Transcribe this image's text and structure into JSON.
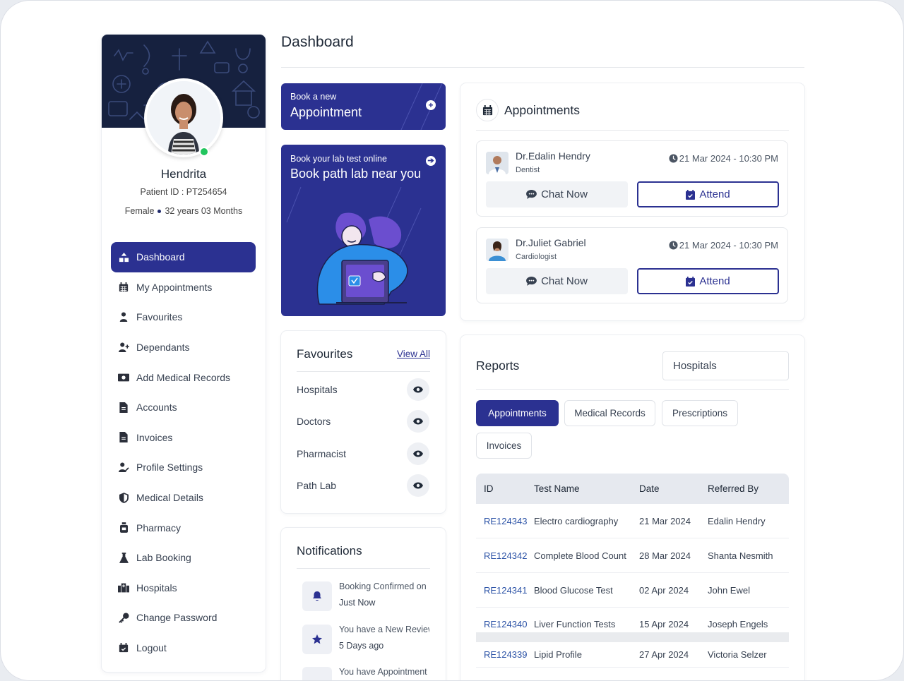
{
  "page": {
    "title": "Dashboard"
  },
  "profile": {
    "name": "Hendrita",
    "patient_id": "Patient ID : PT254654",
    "gender": "Female",
    "age": "32 years 03 Months"
  },
  "sidebar": {
    "items": [
      {
        "label": "Dashboard",
        "icon": "dashboard-icon",
        "active": true
      },
      {
        "label": "My Appointments",
        "icon": "calendar-icon"
      },
      {
        "label": "Favourites",
        "icon": "user-heart-icon"
      },
      {
        "label": "Dependants",
        "icon": "user-plus-icon"
      },
      {
        "label": "Add Medical Records",
        "icon": "money-icon"
      },
      {
        "label": "Accounts",
        "icon": "file-icon"
      },
      {
        "label": "Invoices",
        "icon": "file-text-icon"
      },
      {
        "label": "Profile Settings",
        "icon": "user-edit-icon"
      },
      {
        "label": "Medical Details",
        "icon": "shield-icon"
      },
      {
        "label": "Pharmacy",
        "icon": "bottle-icon"
      },
      {
        "label": "Lab Booking",
        "icon": "flask-icon"
      },
      {
        "label": "Hospitals",
        "icon": "hospital-icon"
      },
      {
        "label": "Change Password",
        "icon": "key-icon"
      },
      {
        "label": "Logout",
        "icon": "calendar-check-icon"
      }
    ]
  },
  "book_appointment": {
    "line1": "Book a new",
    "line2": "Appointment"
  },
  "lab_booking": {
    "line1": "Book your lab test online",
    "line2": "Book path lab near you"
  },
  "favourites": {
    "title": "Favourites",
    "view_all": "View All",
    "items": [
      "Hospitals",
      "Doctors",
      "Pharmacist",
      "Path Lab"
    ]
  },
  "notifications": {
    "title": "Notifications",
    "items": [
      {
        "text": "Booking Confirmed on",
        "time": "Just Now",
        "icon": "bell-icon"
      },
      {
        "text": "You have a New Review",
        "time": "5 Days ago",
        "icon": "star-icon"
      },
      {
        "text": "You have Appointment",
        "time": "",
        "icon": "calendar-icon"
      }
    ]
  },
  "appointments": {
    "title": "Appointments",
    "items": [
      {
        "name": "Dr.Edalin Hendry",
        "specialty": "Dentist",
        "time": "21 Mar 2024 - 10:30 PM",
        "chat": "Chat Now",
        "attend": "Attend"
      },
      {
        "name": "Dr.Juliet Gabriel",
        "specialty": "Cardiologist",
        "time": "21 Mar 2024 - 10:30 PM",
        "chat": "Chat Now",
        "attend": "Attend"
      }
    ]
  },
  "reports": {
    "title": "Reports",
    "filter_value": "Hospitals",
    "tabs": [
      "Appointments",
      "Medical Records",
      "Prescriptions",
      "Invoices"
    ],
    "columns": [
      "ID",
      "Test Name",
      "Date",
      "Referred By"
    ],
    "rows": [
      [
        "RE124343",
        "Electro cardiography",
        "21 Mar 2024",
        "Edalin Hendry"
      ],
      [
        "RE124342",
        "Complete Blood Count",
        "28 Mar 2024",
        "Shanta Nesmith"
      ],
      [
        "RE124341",
        "Blood Glucose Test",
        "02 Apr 2024",
        "John Ewel"
      ],
      [
        "RE124340",
        "Liver Function Tests",
        "15 Apr 2024",
        "Joseph Engels"
      ],
      [
        "RE124339",
        "Lipid Profile",
        "27 Apr 2024",
        "Victoria Selzer"
      ]
    ]
  },
  "colors": {
    "primary": "#2b3191",
    "online": "#22c55e"
  }
}
